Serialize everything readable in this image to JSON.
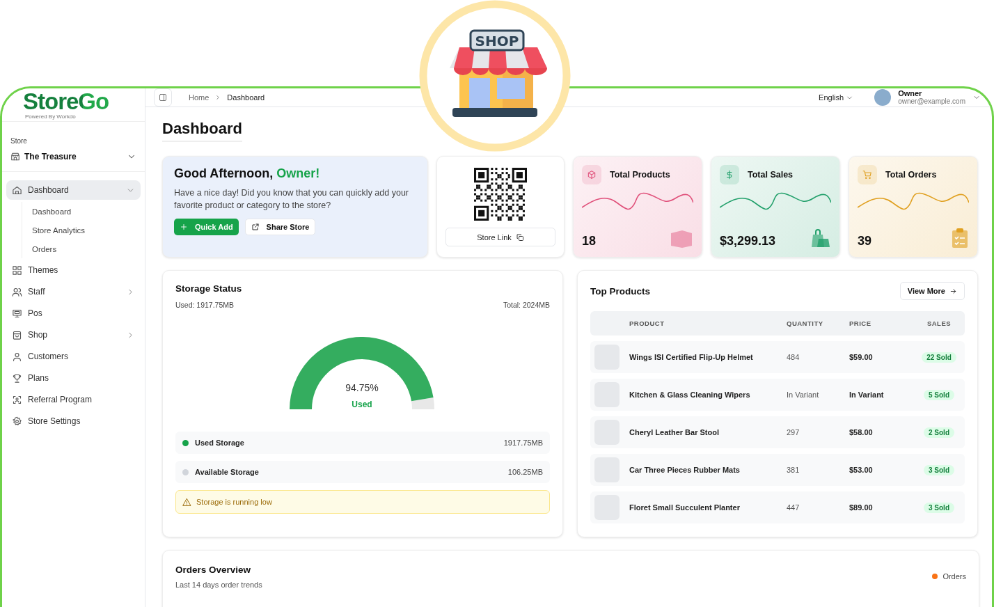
{
  "shop_badge": {
    "sign": "SHOP"
  },
  "sidebar": {
    "logo": "StoreGo",
    "logo_tagline": "Powered By Workdo",
    "store_label": "Store",
    "store_name": "The Treasure",
    "items": [
      {
        "label": "Dashboard",
        "selected": true,
        "expanded": true,
        "children": [
          {
            "label": "Dashboard"
          },
          {
            "label": "Store Analytics"
          },
          {
            "label": "Orders"
          }
        ]
      },
      {
        "label": "Themes",
        "selected": false
      },
      {
        "label": "Staff",
        "selected": false,
        "expanded": false
      },
      {
        "label": "Pos",
        "selected": false
      },
      {
        "label": "Shop",
        "selected": false,
        "expanded": false
      },
      {
        "label": "Customers",
        "selected": false
      },
      {
        "label": "Plans",
        "selected": false
      },
      {
        "label": "Referral Program",
        "selected": false
      },
      {
        "label": "Store Settings",
        "selected": false
      }
    ]
  },
  "header": {
    "breadcrumb": [
      "Home",
      "Dashboard"
    ],
    "language": "English",
    "user": {
      "name": "Owner",
      "email": "owner@example.com"
    }
  },
  "page_title": "Dashboard",
  "welcome": {
    "greeting": "Good Afternoon,",
    "name": "Owner!",
    "message": "Have a nice day! Did you know that you can quickly add your favorite product or category to the store?",
    "buttons": [
      {
        "label": "Quick Add",
        "kind": "primary"
      },
      {
        "label": "Share Store",
        "kind": "outline"
      }
    ]
  },
  "qr": {
    "button": "Store Link"
  },
  "stats": [
    {
      "title": "Total Products",
      "value": "18",
      "color": "#e0507a"
    },
    {
      "title": "Total Sales",
      "value": "$3,299.13",
      "color": "#22a06b"
    },
    {
      "title": "Total Orders",
      "value": "39",
      "color": "#e0a020"
    }
  ],
  "storage": {
    "title": "Storage Status",
    "used": "Used: 1917.75MB",
    "total": "Total: 2024MB",
    "gauge": {
      "level": 0.9475,
      "percent": "94.75%",
      "label": "Used"
    },
    "legend": [
      {
        "label": "Used Storage",
        "value": "1917.75MB",
        "color": "#16a34a"
      },
      {
        "label": "Available Storage",
        "value": "106.25MB",
        "color": "#d1d5db"
      }
    ],
    "warning": "Storage is running low"
  },
  "top_products": {
    "title": "Top Products",
    "button": "View More",
    "columns": [
      "PRODUCT",
      "QUANTITY",
      "PRICE",
      "SALES"
    ],
    "rows": [
      {
        "product": "Wings ISI Certified Flip-Up Helmet",
        "quantity": "484",
        "price": "$59.00",
        "sales": "22 Sold"
      },
      {
        "product": "Kitchen & Glass Cleaning Wipers",
        "quantity": "In Variant",
        "price": "In Variant",
        "sales": "5 Sold"
      },
      {
        "product": "Cheryl Leather Bar Stool",
        "quantity": "297",
        "price": "$58.00",
        "sales": "2 Sold"
      },
      {
        "product": "Car Three Pieces Rubber Mats",
        "quantity": "381",
        "price": "$53.00",
        "sales": "3 Sold"
      },
      {
        "product": "Floret Small Succulent Planter",
        "quantity": "447",
        "price": "$89.00",
        "sales": "3 Sold"
      }
    ]
  },
  "orders_overview": {
    "title": "Orders Overview",
    "subtitle": "Last 14 days order trends",
    "legend": [
      {
        "label": "Orders",
        "color": "#f97316"
      }
    ]
  }
}
